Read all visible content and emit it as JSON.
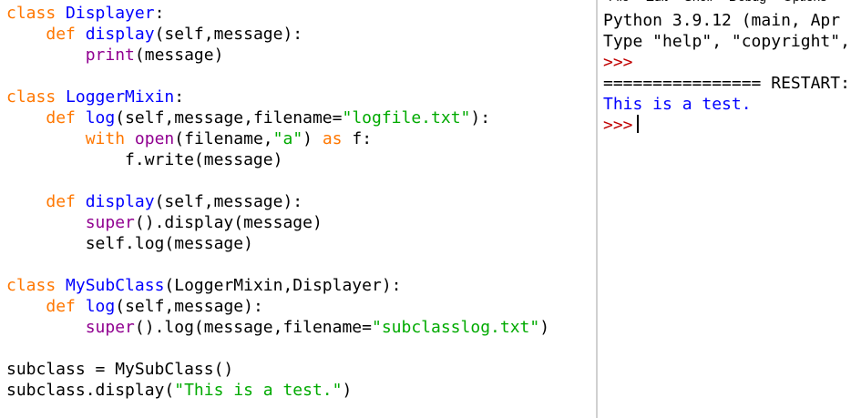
{
  "editor": {
    "lines": [
      [
        {
          "t": "class",
          "c": "kw"
        },
        {
          "t": " ",
          "c": "plain"
        },
        {
          "t": "Displayer",
          "c": "def"
        },
        {
          "t": ":",
          "c": "plain"
        }
      ],
      [
        {
          "t": "    ",
          "c": "plain"
        },
        {
          "t": "def",
          "c": "kw"
        },
        {
          "t": " ",
          "c": "plain"
        },
        {
          "t": "display",
          "c": "def"
        },
        {
          "t": "(self,message):",
          "c": "plain"
        }
      ],
      [
        {
          "t": "        ",
          "c": "plain"
        },
        {
          "t": "print",
          "c": "bi"
        },
        {
          "t": "(message)",
          "c": "plain"
        }
      ],
      [],
      [
        {
          "t": "class",
          "c": "kw"
        },
        {
          "t": " ",
          "c": "plain"
        },
        {
          "t": "LoggerMixin",
          "c": "def"
        },
        {
          "t": ":",
          "c": "plain"
        }
      ],
      [
        {
          "t": "    ",
          "c": "plain"
        },
        {
          "t": "def",
          "c": "kw"
        },
        {
          "t": " ",
          "c": "plain"
        },
        {
          "t": "log",
          "c": "def"
        },
        {
          "t": "(self,message,filename=",
          "c": "plain"
        },
        {
          "t": "\"logfile.txt\"",
          "c": "str"
        },
        {
          "t": "):",
          "c": "plain"
        }
      ],
      [
        {
          "t": "        ",
          "c": "plain"
        },
        {
          "t": "with",
          "c": "kw"
        },
        {
          "t": " ",
          "c": "plain"
        },
        {
          "t": "open",
          "c": "bi"
        },
        {
          "t": "(filename,",
          "c": "plain"
        },
        {
          "t": "\"a\"",
          "c": "str"
        },
        {
          "t": ") ",
          "c": "plain"
        },
        {
          "t": "as",
          "c": "kw"
        },
        {
          "t": " f:",
          "c": "plain"
        }
      ],
      [
        {
          "t": "            f.write(message)",
          "c": "plain"
        }
      ],
      [],
      [
        {
          "t": "    ",
          "c": "plain"
        },
        {
          "t": "def",
          "c": "kw"
        },
        {
          "t": " ",
          "c": "plain"
        },
        {
          "t": "display",
          "c": "def"
        },
        {
          "t": "(self,message):",
          "c": "plain"
        }
      ],
      [
        {
          "t": "        ",
          "c": "plain"
        },
        {
          "t": "super",
          "c": "bi"
        },
        {
          "t": "().display(message)",
          "c": "plain"
        }
      ],
      [
        {
          "t": "        self.log(message)",
          "c": "plain"
        }
      ],
      [],
      [
        {
          "t": "class",
          "c": "kw"
        },
        {
          "t": " ",
          "c": "plain"
        },
        {
          "t": "MySubClass",
          "c": "def"
        },
        {
          "t": "(LoggerMixin,Displayer):",
          "c": "plain"
        }
      ],
      [
        {
          "t": "    ",
          "c": "plain"
        },
        {
          "t": "def",
          "c": "kw"
        },
        {
          "t": " ",
          "c": "plain"
        },
        {
          "t": "log",
          "c": "def"
        },
        {
          "t": "(self,message):",
          "c": "plain"
        }
      ],
      [
        {
          "t": "        ",
          "c": "plain"
        },
        {
          "t": "super",
          "c": "bi"
        },
        {
          "t": "().log(message,filename=",
          "c": "plain"
        },
        {
          "t": "\"subclasslog.txt\"",
          "c": "str"
        },
        {
          "t": ")",
          "c": "plain"
        }
      ],
      [],
      [
        {
          "t": "subclass = MySubClass()",
          "c": "plain"
        }
      ],
      [
        {
          "t": "subclass.display(",
          "c": "plain"
        },
        {
          "t": "\"This is a test.\"",
          "c": "str"
        },
        {
          "t": ")",
          "c": "plain"
        }
      ]
    ]
  },
  "shell": {
    "menu": [
      "File",
      "Edit",
      "Shell",
      "Debug",
      "Options"
    ],
    "lines": [
      [
        {
          "t": "Python 3.9.12 (main, Apr",
          "c": "plain"
        }
      ],
      [
        {
          "t": "Type \"help\", \"copyright\",",
          "c": "plain"
        }
      ],
      [
        {
          "t": ">>>",
          "c": "prompt"
        }
      ],
      [
        {
          "t": "================ RESTART:",
          "c": "plain"
        }
      ],
      [
        {
          "t": "This is a test.",
          "c": "out"
        }
      ],
      [
        {
          "t": ">>>",
          "c": "prompt"
        }
      ]
    ]
  },
  "colors": {
    "keyword": "#ff7700",
    "definition": "#0000ff",
    "string": "#00aa00",
    "builtin": "#900090",
    "prompt": "#c00000",
    "stdout": "#0000ff"
  }
}
